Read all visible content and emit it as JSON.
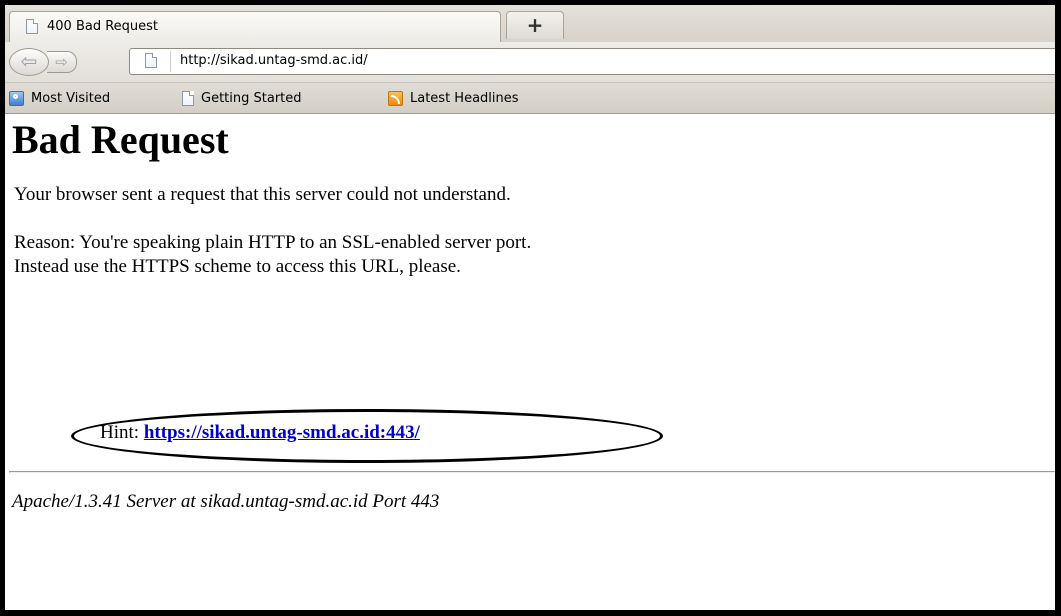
{
  "browser": {
    "tab": {
      "title": "400 Bad Request",
      "icon": "page-icon"
    },
    "new_tab_label": "+",
    "nav": {
      "back_glyph": "⇦",
      "forward_glyph": "⇨"
    },
    "url": "http://sikad.untag-smd.ac.id/",
    "bookmarks": [
      {
        "label": "Most Visited",
        "icon": "most-visited-icon"
      },
      {
        "label": "Getting Started",
        "icon": "page-icon"
      },
      {
        "label": "Latest Headlines",
        "icon": "rss-icon"
      }
    ]
  },
  "page": {
    "heading": "Bad Request",
    "paragraph1": "Your browser sent a request that this server could not understand.",
    "reason_line1": "Reason: You're speaking plain HTTP to an SSL-enabled server port.",
    "reason_line2": "Instead use the HTTPS scheme to access this URL, please.",
    "hint_label": "Hint: ",
    "hint_link": "https://sikad.untag-smd.ac.id:443/",
    "footer": "Apache/1.3.41 Server at sikad.untag-smd.ac.id Port 443"
  },
  "colors": {
    "link": "#0000cc",
    "chrome": "#e0ddd6",
    "frame": "#000000"
  }
}
